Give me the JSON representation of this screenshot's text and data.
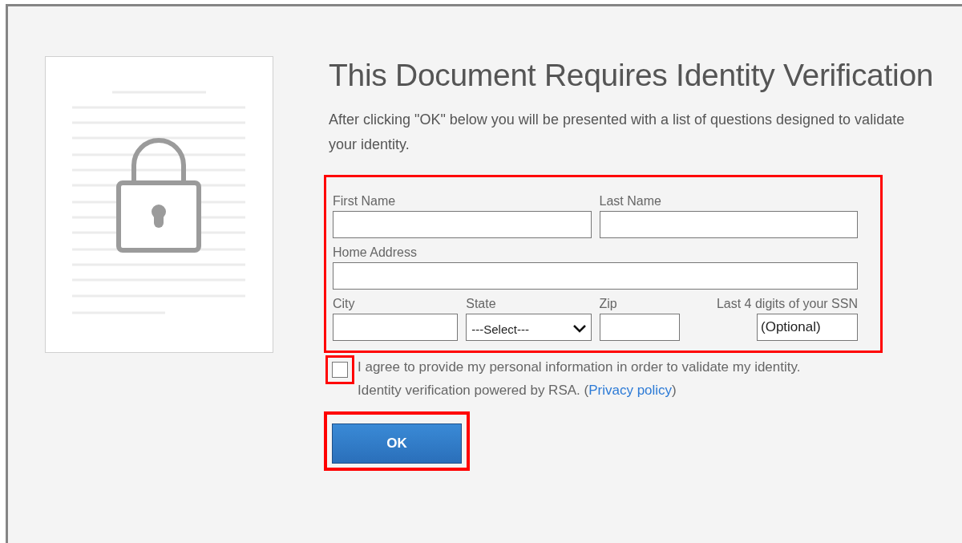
{
  "title": "This Document Requires Identity Verification",
  "intro": "After clicking \"OK\" below you will be presented with a list of questions designed to validate your identity.",
  "form": {
    "highlighted": true,
    "fields": [
      {
        "label": "First Name",
        "kind": "text"
      },
      {
        "label": "Last Name",
        "kind": "text"
      },
      {
        "label": "Home Address",
        "kind": "text"
      },
      {
        "label": "City",
        "kind": "text"
      },
      {
        "label": "State",
        "kind": "select",
        "value": "---Select---"
      },
      {
        "label": "Zip",
        "kind": "text"
      },
      {
        "label": "Last 4 digits of your SSN",
        "kind": "text",
        "placeholder": "(Optional)"
      }
    ]
  },
  "agreement": {
    "checked": false,
    "highlighted": true,
    "text": "I agree to provide my personal information in order to validate my identity. Identity verification powered by RSA. (",
    "link": "Privacy policy",
    "after": ")"
  },
  "ok_button": {
    "label": "OK",
    "highlighted": true
  }
}
